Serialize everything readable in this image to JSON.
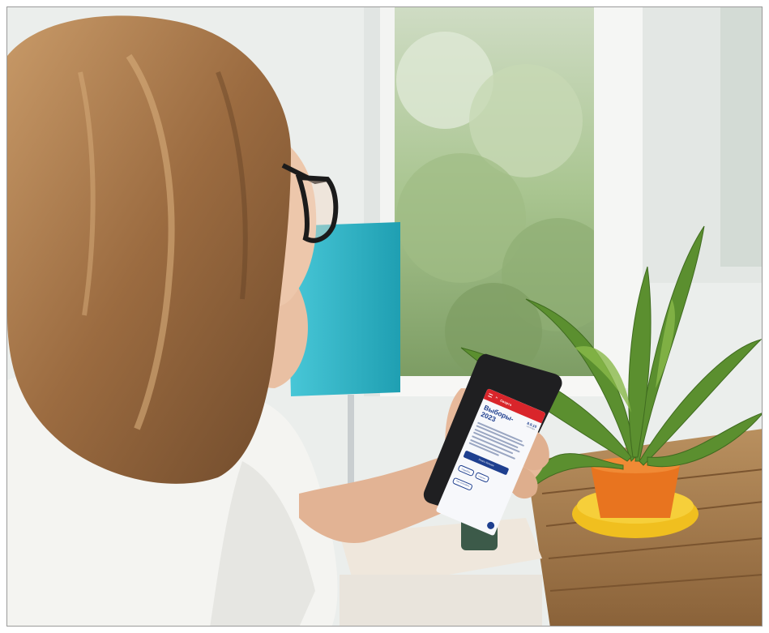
{
  "scene": {
    "description_elements": [
      "woman",
      "glasses",
      "smartphone",
      "teal-lamp",
      "window",
      "potted-plant",
      "wooden-table"
    ]
  },
  "phone": {
    "brand": "Сварта",
    "title_line1": "Выборы-",
    "title_line2": "2023",
    "date_main": "8.9.10",
    "date_sub": "сентября",
    "primary_button": "Узнать больше",
    "chips": [
      "Подробно",
      "Участки"
    ],
    "chip_wide": "Как голосовать"
  },
  "colors": {
    "phone_header": "#d9252b",
    "phone_accent": "#1e3f8f",
    "lamp": "#2fb6c8",
    "pot": "#e8741f",
    "saucer": "#f2c21b"
  }
}
